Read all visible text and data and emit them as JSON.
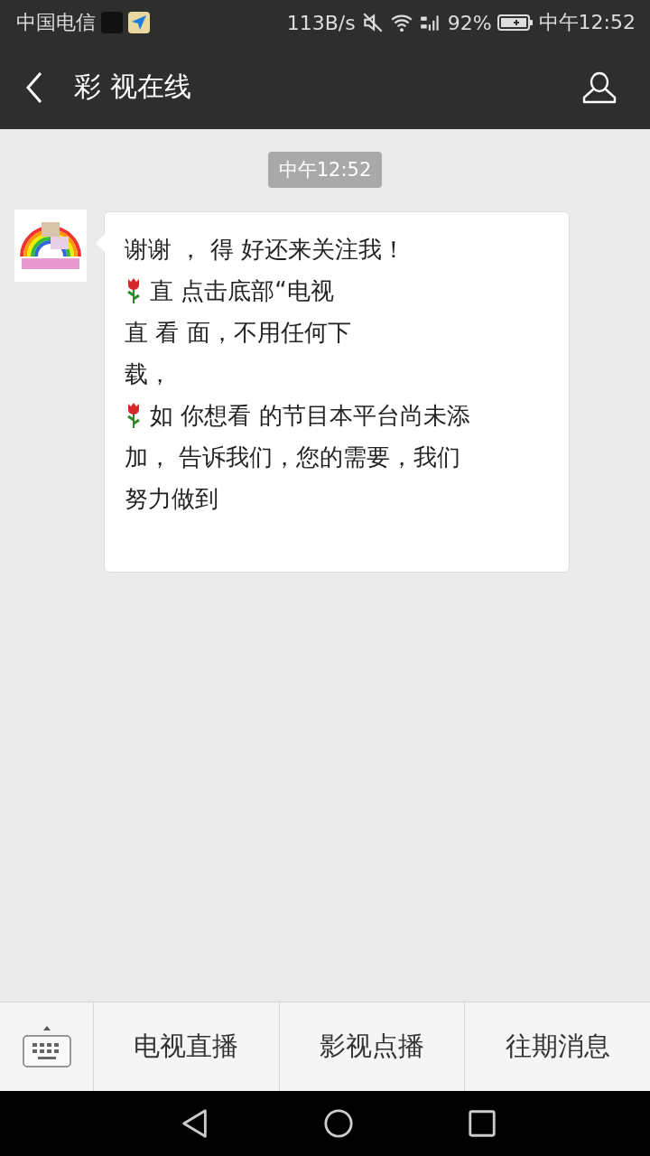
{
  "status_bar": {
    "carrier": "中国电信",
    "speed": "113B/s",
    "battery": "92%",
    "time": "中午12:52"
  },
  "header": {
    "title": "彩 视在线"
  },
  "timestamp": "中午12:52",
  "message": {
    "lines": [
      {
        "kind": "text",
        "text": "谢谢 ， 得 好还来关注我！"
      },
      {
        "kind": "rose",
        "text": "直 点击底部“电视"
      },
      {
        "kind": "text",
        "text": "直 看 面，不用任何下"
      },
      {
        "kind": "text",
        "text": "载，"
      },
      {
        "kind": "rose",
        "text": "如 你想看 的节目本平台尚未添"
      },
      {
        "kind": "text",
        "text": "加， 告诉我们，您的需要，我们"
      },
      {
        "kind": "text",
        "text": "努力做到"
      }
    ]
  },
  "menu": [
    "电视直播",
    "影视点播",
    "往期消息"
  ]
}
